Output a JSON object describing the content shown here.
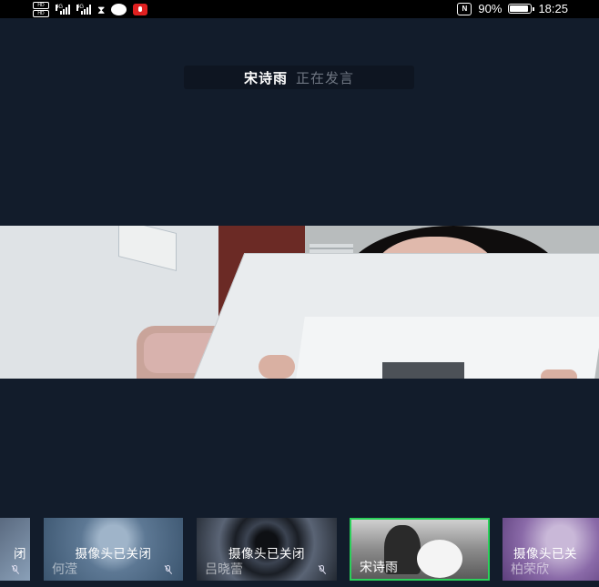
{
  "status_bar": {
    "hd_label": "HD",
    "signal1_label": "4G",
    "signal2_label": "4G",
    "nfc_label": "N",
    "battery_percent": "90%",
    "battery_level": 0.9,
    "time": "18:25"
  },
  "speaker_banner": {
    "name": "宋诗雨",
    "status": "正在发言"
  },
  "participants": [
    {
      "name": "",
      "camera_status": "闭",
      "muted": true
    },
    {
      "name": "何滢",
      "camera_status": "摄像头已关闭",
      "muted": true
    },
    {
      "name": "吕晓蕾",
      "camera_status": "摄像头已关闭",
      "muted": true
    },
    {
      "name": "宋诗雨",
      "camera_status": "",
      "muted": false,
      "active": true
    },
    {
      "name": "柏荣欣",
      "camera_status": "摄像头已关",
      "muted": true
    }
  ],
  "colors": {
    "background": "#121c2b",
    "active_border": "#2bd05a",
    "recording": "#e02020"
  }
}
